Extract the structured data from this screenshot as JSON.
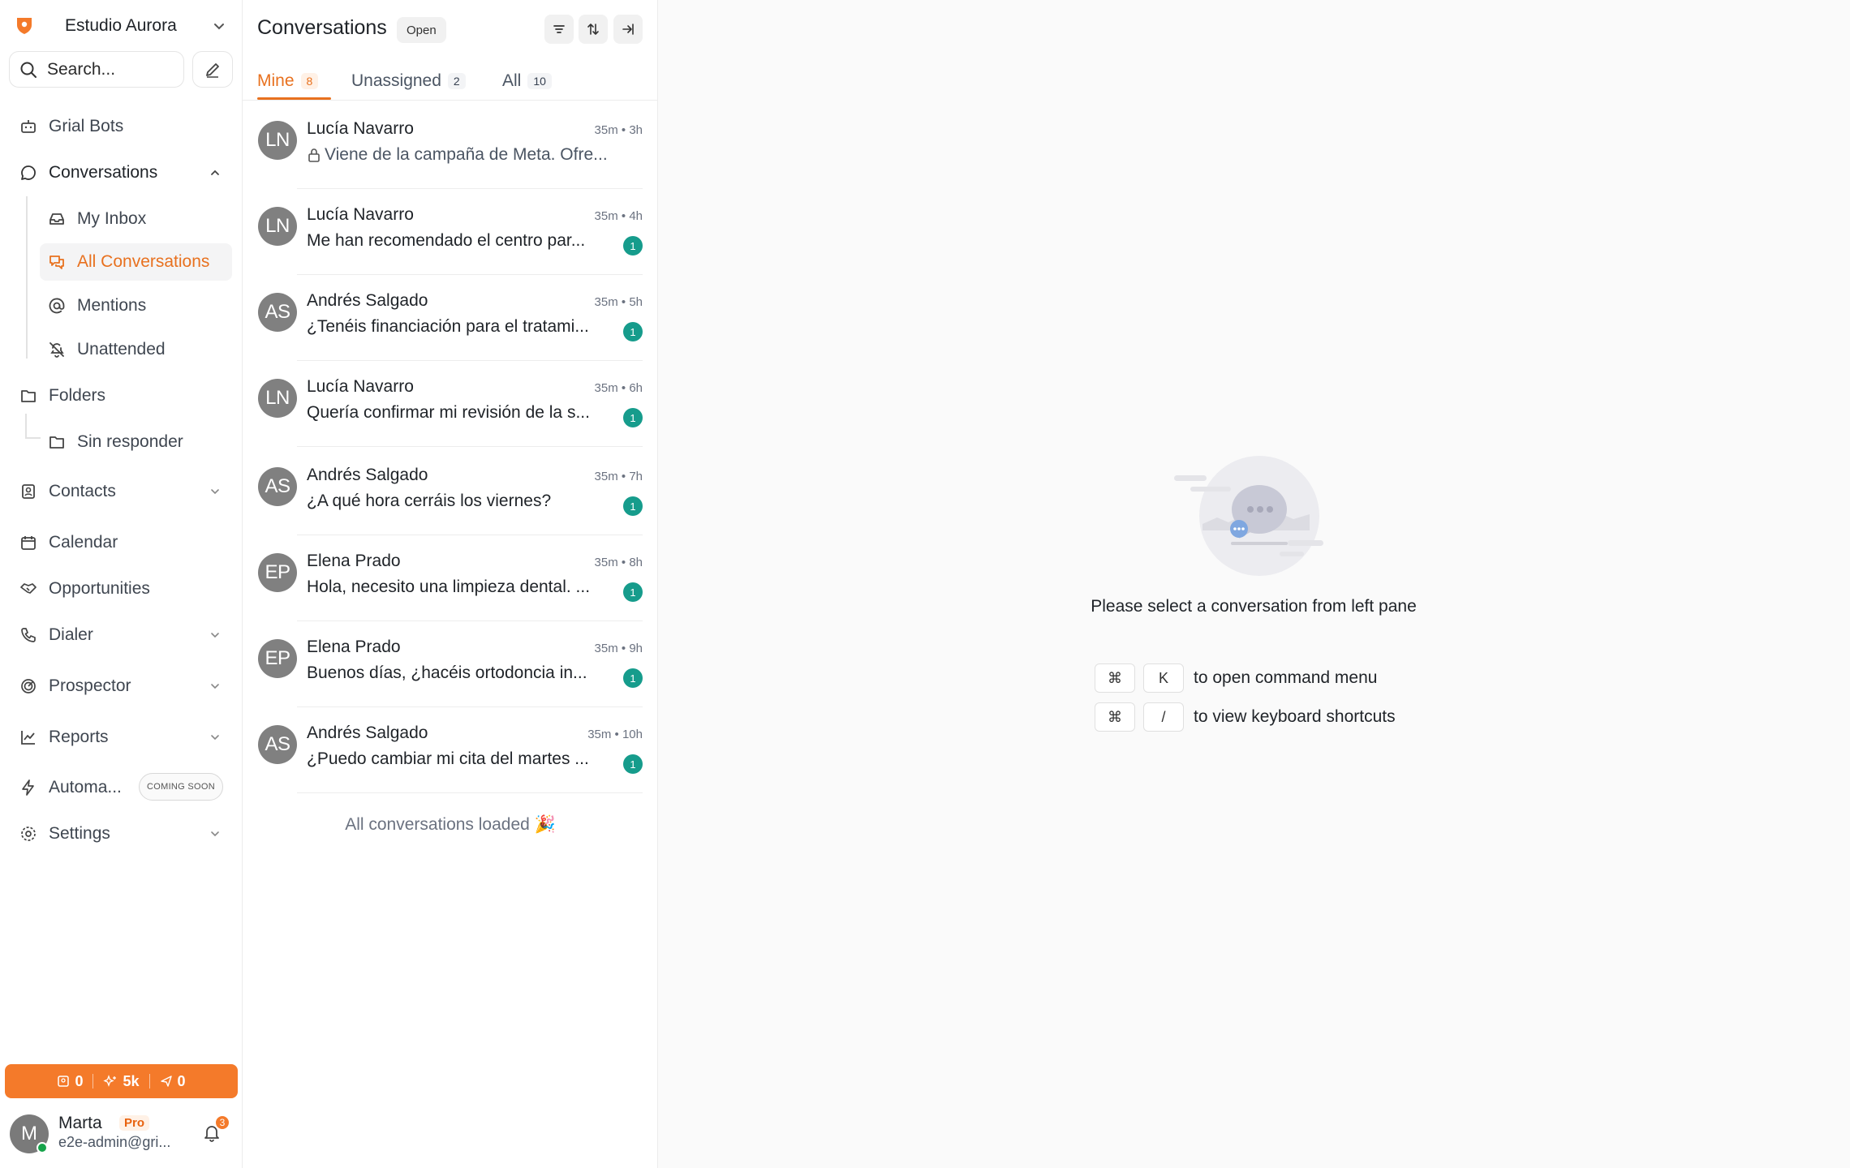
{
  "workspace": {
    "name": "Estudio Aurora"
  },
  "search": {
    "placeholder": "Search..."
  },
  "nav": {
    "grial_bots": "Grial Bots",
    "conversations": "Conversations",
    "my_inbox": "My Inbox",
    "all_conversations": "All Conversations",
    "mentions": "Mentions",
    "unattended": "Unattended",
    "folders": "Folders",
    "sin_responder": "Sin responder",
    "contacts": "Contacts",
    "calendar": "Calendar",
    "opportunities": "Opportunities",
    "dialer": "Dialer",
    "prospector": "Prospector",
    "reports": "Reports",
    "automations": "Automa...",
    "coming_soon": "COMING SOON",
    "settings": "Settings"
  },
  "usage": {
    "contacts": "0",
    "credits": "5k",
    "sent": "0"
  },
  "user": {
    "name": "Marta",
    "initial": "M",
    "plan": "Pro",
    "email": "e2e-admin@gri...",
    "notifications": "3"
  },
  "list": {
    "title": "Conversations",
    "status": "Open",
    "tabs": [
      {
        "label": "Mine",
        "count": "8"
      },
      {
        "label": "Unassigned",
        "count": "2"
      },
      {
        "label": "All",
        "count": "10"
      }
    ],
    "conversations": [
      {
        "initials": "LN",
        "name": "Lucía Navarro",
        "time": "35m • 3h",
        "message": "Viene de la campaña de Meta. Ofre...",
        "private": true,
        "unread": ""
      },
      {
        "initials": "LN",
        "name": "Lucía Navarro",
        "time": "35m • 4h",
        "message": "Me han recomendado el centro par...",
        "private": false,
        "unread": "1"
      },
      {
        "initials": "AS",
        "name": "Andrés Salgado",
        "time": "35m • 5h",
        "message": "¿Tenéis financiación para el tratami...",
        "private": false,
        "unread": "1"
      },
      {
        "initials": "LN",
        "name": "Lucía Navarro",
        "time": "35m • 6h",
        "message": "Quería confirmar mi revisión de la s...",
        "private": false,
        "unread": "1"
      },
      {
        "initials": "AS",
        "name": "Andrés Salgado",
        "time": "35m • 7h",
        "message": "¿A qué hora cerráis los viernes?",
        "private": false,
        "unread": "1"
      },
      {
        "initials": "EP",
        "name": "Elena Prado",
        "time": "35m • 8h",
        "message": "Hola, necesito una limpieza dental. ...",
        "private": false,
        "unread": "1"
      },
      {
        "initials": "EP",
        "name": "Elena Prado",
        "time": "35m • 9h",
        "message": "Buenos días, ¿hacéis ortodoncia in...",
        "private": false,
        "unread": "1"
      },
      {
        "initials": "AS",
        "name": "Andrés Salgado",
        "time": "35m • 10h",
        "message": "¿Puedo cambiar mi cita del martes ...",
        "private": false,
        "unread": "1"
      }
    ],
    "loaded_message": "All conversations loaded 🎉"
  },
  "empty_state": {
    "message": "Please select a conversation from left pane",
    "shortcuts": [
      {
        "keys": [
          "⌘",
          "K"
        ],
        "description": "to open command menu"
      },
      {
        "keys": [
          "⌘",
          "/"
        ],
        "description": "to view keyboard shortcuts"
      }
    ]
  },
  "colors": {
    "accent": "#e8711f",
    "unread": "#169c8c",
    "usage_bar": "#f47a2a"
  }
}
